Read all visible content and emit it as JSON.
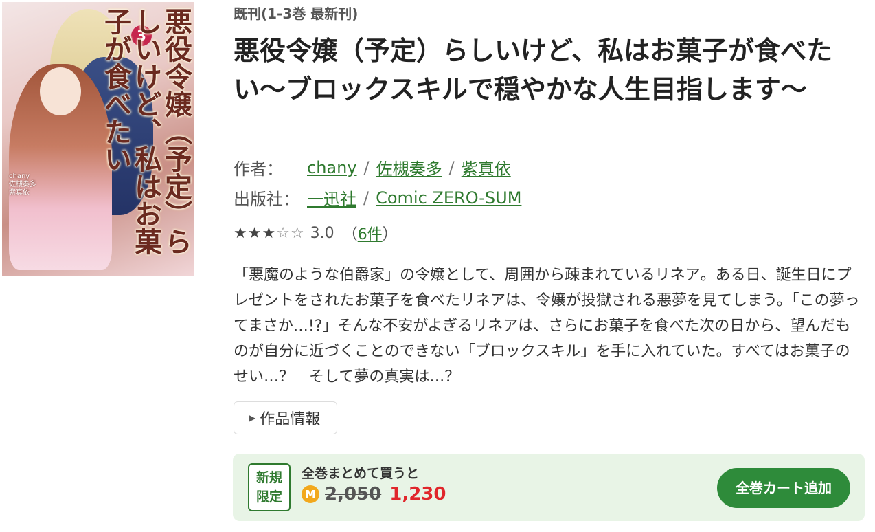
{
  "cover": {
    "title_text": "悪役令嬢（予定）らしいけど、私はお菓子が食べたい",
    "volume": "3",
    "authors_text": "chany\n佐槻奏多\n紫真依"
  },
  "status": "既刊(1-3巻 最新刊)",
  "title": "悪役令嬢（予定）らしいけど、私はお菓子が食べたい～ブロックスキルで穏やかな人生目指します～",
  "author": {
    "label": "作者：",
    "names": [
      "chany",
      "佐槻奏多",
      "紫真依"
    ],
    "sep": "/"
  },
  "publisher": {
    "label": "出版社：",
    "names": [
      "一迅社",
      "Comic ZERO-SUM"
    ],
    "sep": "/"
  },
  "rating": {
    "stars_filled": 3,
    "stars_total": 5,
    "score": "3.0",
    "open_paren": "（",
    "count": "6件",
    "close_paren": "）"
  },
  "description": "「悪魔のような伯爵家」の令嬢として、周囲から疎まれているリネア。ある日、誕生日にプレゼントをされたお菓子を食べたリネアは、令嬢が投獄される悪夢を見てしまう。「この夢ってまさか…!?」そんな不安がよぎるリネアは、さらにお菓子を食べた次の日から、望んだものが自分に近づくことのできない「ブロックスキル」を手に入れていた。すべてはお菓子のせい…？　そして夢の真実は…？",
  "info_button": "作品情報",
  "promo": {
    "badge_line1": "新規",
    "badge_line2": "限定",
    "caption": "全巻まとめて買うと",
    "coin_icon": "M",
    "old_price": "2,050",
    "new_price": "1,230",
    "cart_button": "全巻カート追加",
    "colors": {
      "price_red": "#e0262b",
      "button_green": "#2e8b3a",
      "background": "#e8f4e6"
    }
  }
}
